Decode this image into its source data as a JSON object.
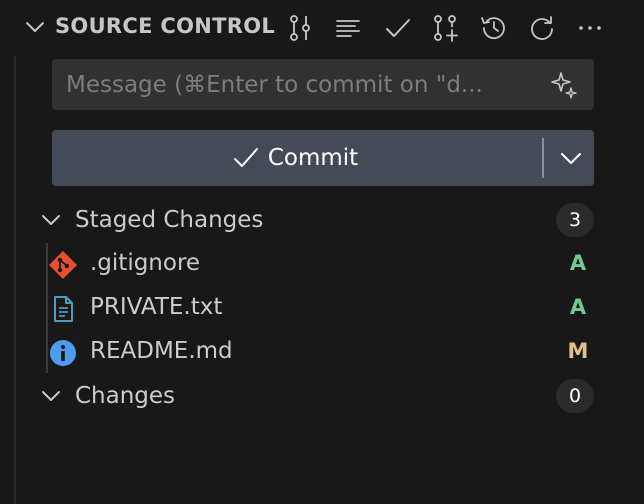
{
  "header": {
    "title": "SOURCE CONTROL",
    "icons": [
      "graph-icon",
      "list-view-icon",
      "checkmark-icon",
      "pull-request-icon",
      "history-icon",
      "refresh-icon",
      "more-icon"
    ]
  },
  "commit_message": {
    "value": "",
    "placeholder": "Message (⌘Enter to commit on \"d..."
  },
  "commit_button": {
    "label": "Commit"
  },
  "staged": {
    "label": "Staged Changes",
    "count": "3",
    "files": [
      {
        "name": ".gitignore",
        "status": "A",
        "icon": "git-file-icon"
      },
      {
        "name": "PRIVATE.txt",
        "status": "A",
        "icon": "text-file-icon"
      },
      {
        "name": "README.md",
        "status": "M",
        "icon": "info-file-icon"
      }
    ]
  },
  "changes": {
    "label": "Changes",
    "count": "0"
  },
  "colors": {
    "background": "#181818",
    "added": "#73c991",
    "modified": "#e2c08d",
    "commit_button": "#444b57"
  }
}
